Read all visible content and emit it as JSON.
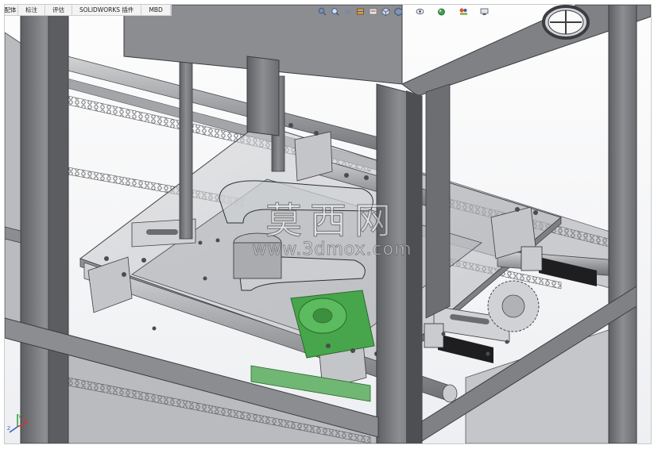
{
  "tabs": [
    {
      "label": "装配体"
    },
    {
      "label": "标注"
    },
    {
      "label": "评估"
    },
    {
      "label": "SOLIDWORKS 插件"
    },
    {
      "label": "MBD"
    }
  ],
  "view_toolbar": [
    {
      "icon": "zoom-to-fit-icon"
    },
    {
      "icon": "zoom-to-area-icon"
    },
    {
      "icon": "previous-view-icon"
    },
    {
      "icon": "section-view-icon"
    },
    {
      "icon": "dynamic-annotation-icon"
    },
    {
      "icon": "view-orientation-icon"
    },
    {
      "icon": "display-style-icon"
    },
    {
      "icon": "hide-show-items-icon"
    },
    {
      "icon": "edit-appearance-icon"
    },
    {
      "icon": "apply-scene-icon"
    },
    {
      "icon": "view-settings-icon"
    }
  ],
  "watermark": {
    "brand": "莫西网",
    "url": "www.3dmox.com"
  },
  "colors": {
    "frame_steel": "#7f8184",
    "frame_steel_dark": "#4d4f53",
    "plate": "#c6c8cb",
    "green_part": "#47a64b",
    "rubber_black": "#1e1e20",
    "chain": "#8a8c90"
  }
}
